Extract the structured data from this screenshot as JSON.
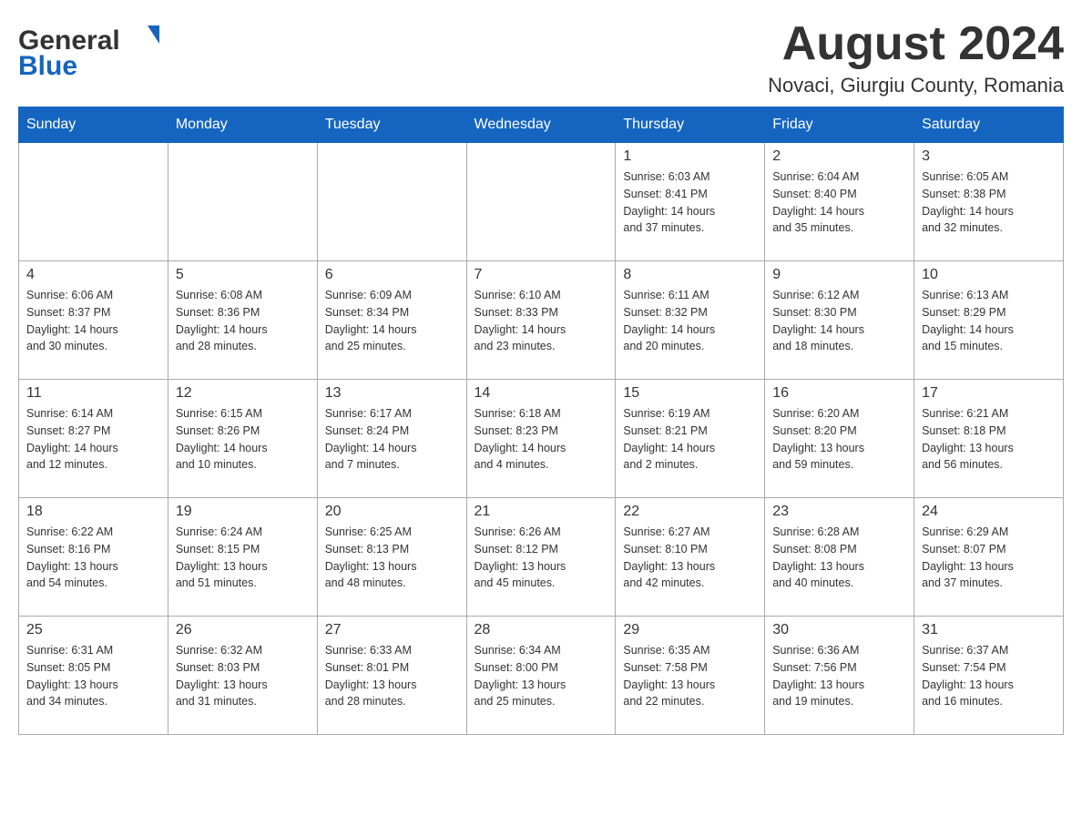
{
  "logo": {
    "general": "General",
    "blue": "Blue",
    "alt": "GeneralBlue logo"
  },
  "header": {
    "month": "August 2024",
    "location": "Novaci, Giurgiu County, Romania"
  },
  "weekdays": [
    "Sunday",
    "Monday",
    "Tuesday",
    "Wednesday",
    "Thursday",
    "Friday",
    "Saturday"
  ],
  "weeks": [
    [
      {
        "day": "",
        "info": ""
      },
      {
        "day": "",
        "info": ""
      },
      {
        "day": "",
        "info": ""
      },
      {
        "day": "",
        "info": ""
      },
      {
        "day": "1",
        "info": "Sunrise: 6:03 AM\nSunset: 8:41 PM\nDaylight: 14 hours\nand 37 minutes."
      },
      {
        "day": "2",
        "info": "Sunrise: 6:04 AM\nSunset: 8:40 PM\nDaylight: 14 hours\nand 35 minutes."
      },
      {
        "day": "3",
        "info": "Sunrise: 6:05 AM\nSunset: 8:38 PM\nDaylight: 14 hours\nand 32 minutes."
      }
    ],
    [
      {
        "day": "4",
        "info": "Sunrise: 6:06 AM\nSunset: 8:37 PM\nDaylight: 14 hours\nand 30 minutes."
      },
      {
        "day": "5",
        "info": "Sunrise: 6:08 AM\nSunset: 8:36 PM\nDaylight: 14 hours\nand 28 minutes."
      },
      {
        "day": "6",
        "info": "Sunrise: 6:09 AM\nSunset: 8:34 PM\nDaylight: 14 hours\nand 25 minutes."
      },
      {
        "day": "7",
        "info": "Sunrise: 6:10 AM\nSunset: 8:33 PM\nDaylight: 14 hours\nand 23 minutes."
      },
      {
        "day": "8",
        "info": "Sunrise: 6:11 AM\nSunset: 8:32 PM\nDaylight: 14 hours\nand 20 minutes."
      },
      {
        "day": "9",
        "info": "Sunrise: 6:12 AM\nSunset: 8:30 PM\nDaylight: 14 hours\nand 18 minutes."
      },
      {
        "day": "10",
        "info": "Sunrise: 6:13 AM\nSunset: 8:29 PM\nDaylight: 14 hours\nand 15 minutes."
      }
    ],
    [
      {
        "day": "11",
        "info": "Sunrise: 6:14 AM\nSunset: 8:27 PM\nDaylight: 14 hours\nand 12 minutes."
      },
      {
        "day": "12",
        "info": "Sunrise: 6:15 AM\nSunset: 8:26 PM\nDaylight: 14 hours\nand 10 minutes."
      },
      {
        "day": "13",
        "info": "Sunrise: 6:17 AM\nSunset: 8:24 PM\nDaylight: 14 hours\nand 7 minutes."
      },
      {
        "day": "14",
        "info": "Sunrise: 6:18 AM\nSunset: 8:23 PM\nDaylight: 14 hours\nand 4 minutes."
      },
      {
        "day": "15",
        "info": "Sunrise: 6:19 AM\nSunset: 8:21 PM\nDaylight: 14 hours\nand 2 minutes."
      },
      {
        "day": "16",
        "info": "Sunrise: 6:20 AM\nSunset: 8:20 PM\nDaylight: 13 hours\nand 59 minutes."
      },
      {
        "day": "17",
        "info": "Sunrise: 6:21 AM\nSunset: 8:18 PM\nDaylight: 13 hours\nand 56 minutes."
      }
    ],
    [
      {
        "day": "18",
        "info": "Sunrise: 6:22 AM\nSunset: 8:16 PM\nDaylight: 13 hours\nand 54 minutes."
      },
      {
        "day": "19",
        "info": "Sunrise: 6:24 AM\nSunset: 8:15 PM\nDaylight: 13 hours\nand 51 minutes."
      },
      {
        "day": "20",
        "info": "Sunrise: 6:25 AM\nSunset: 8:13 PM\nDaylight: 13 hours\nand 48 minutes."
      },
      {
        "day": "21",
        "info": "Sunrise: 6:26 AM\nSunset: 8:12 PM\nDaylight: 13 hours\nand 45 minutes."
      },
      {
        "day": "22",
        "info": "Sunrise: 6:27 AM\nSunset: 8:10 PM\nDaylight: 13 hours\nand 42 minutes."
      },
      {
        "day": "23",
        "info": "Sunrise: 6:28 AM\nSunset: 8:08 PM\nDaylight: 13 hours\nand 40 minutes."
      },
      {
        "day": "24",
        "info": "Sunrise: 6:29 AM\nSunset: 8:07 PM\nDaylight: 13 hours\nand 37 minutes."
      }
    ],
    [
      {
        "day": "25",
        "info": "Sunrise: 6:31 AM\nSunset: 8:05 PM\nDaylight: 13 hours\nand 34 minutes."
      },
      {
        "day": "26",
        "info": "Sunrise: 6:32 AM\nSunset: 8:03 PM\nDaylight: 13 hours\nand 31 minutes."
      },
      {
        "day": "27",
        "info": "Sunrise: 6:33 AM\nSunset: 8:01 PM\nDaylight: 13 hours\nand 28 minutes."
      },
      {
        "day": "28",
        "info": "Sunrise: 6:34 AM\nSunset: 8:00 PM\nDaylight: 13 hours\nand 25 minutes."
      },
      {
        "day": "29",
        "info": "Sunrise: 6:35 AM\nSunset: 7:58 PM\nDaylight: 13 hours\nand 22 minutes."
      },
      {
        "day": "30",
        "info": "Sunrise: 6:36 AM\nSunset: 7:56 PM\nDaylight: 13 hours\nand 19 minutes."
      },
      {
        "day": "31",
        "info": "Sunrise: 6:37 AM\nSunset: 7:54 PM\nDaylight: 13 hours\nand 16 minutes."
      }
    ]
  ]
}
